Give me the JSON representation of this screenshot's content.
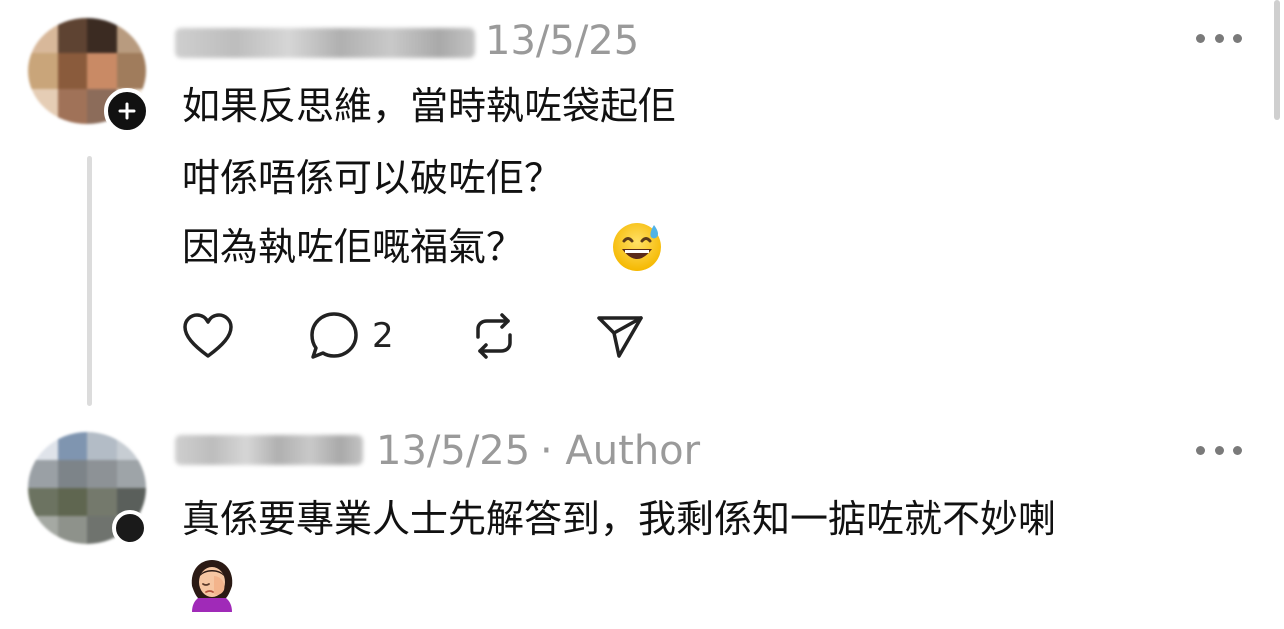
{
  "comments": [
    {
      "date": "13/5/25",
      "author_tag": "",
      "lines": [
        "如果反思維，當時執咗袋起佢",
        "咁係唔係可以破咗佢？",
        "因為執咗佢嘅福氣？"
      ],
      "trailing_emoji": "grinning-face-with-sweat-icon",
      "reply_count": "2",
      "avatar_colors": [
        "#d8b89a",
        "#5e4332",
        "#3b2b22",
        "#b89b7f",
        "#c9a57a",
        "#8a5b3c",
        "#c98a65",
        "#a07c5c",
        "#e5cdb5",
        "#a07258",
        "#8c6c5a",
        "#f1e4d6"
      ]
    },
    {
      "date": "13/5/25",
      "author_tag": "· Author",
      "lines": [
        "真係要專業人士先解答到，我剩係知一掂咗就不妙喇"
      ],
      "trailing_emoji": "person-facepalming-icon",
      "avatar_colors": [
        "#dfe3ea",
        "#7f95b0",
        "#b3bcc6",
        "#c7cdd3",
        "#9aa0a5",
        "#7d8489",
        "#8d9296",
        "#9ea4a8",
        "#6c7361",
        "#5f6650",
        "#74796c",
        "#5a5f5b",
        "#a5a9a3",
        "#8e928b",
        "#6f736e",
        "#e6e7e4"
      ]
    }
  ],
  "colors": {
    "text": "#111111",
    "meta": "#9a9a9a",
    "icon": "#222222",
    "thread_line": "#dcdcdc"
  }
}
